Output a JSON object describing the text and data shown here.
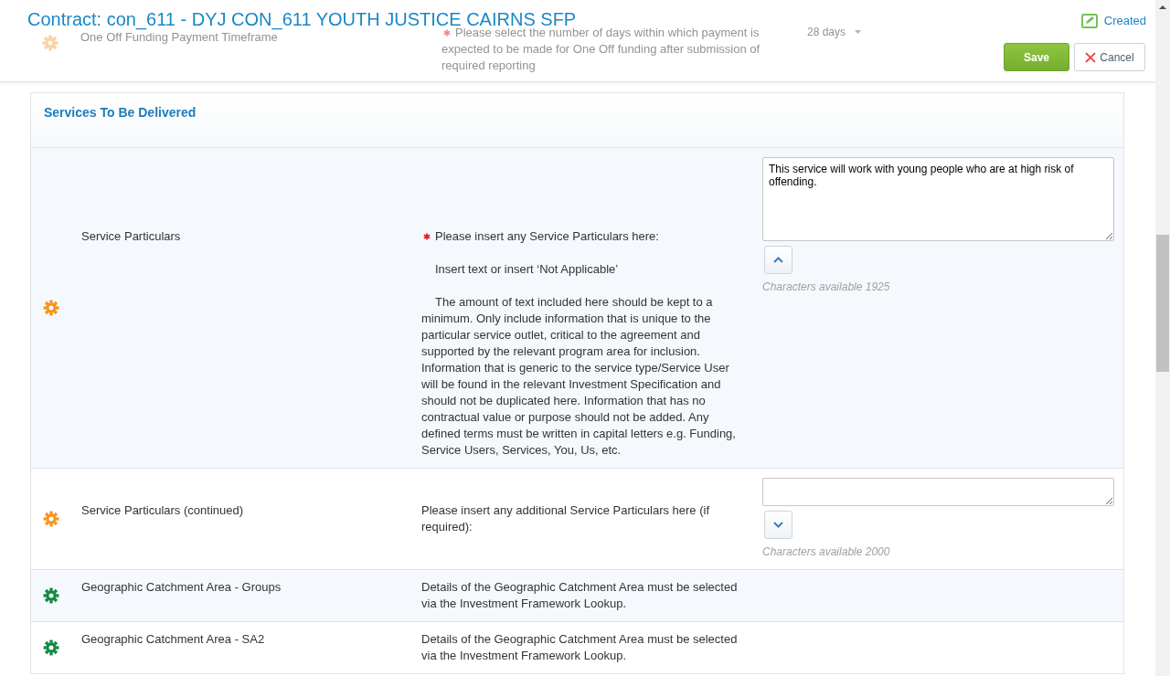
{
  "header": {
    "title": "Contract: con_611 - DYJ CON_611 YOUTH JUSTICE CAIRNS SFP",
    "status": "Created",
    "buttons": [
      {
        "kind": "save",
        "label": "Save"
      },
      {
        "kind": "cancel",
        "label": "Cancel"
      }
    ]
  },
  "previous_row": {
    "label": "One Off Funding Payment Timeframe",
    "required": true,
    "description": "Please select the number of days within which payment is expected to be made for One Off funding after submission of required reporting",
    "dropdown": {
      "value": "28 days"
    }
  },
  "section": {
    "title": "Services To Be Delivered",
    "rows": [
      {
        "kind": "entry",
        "label": "Service Particulars",
        "color": "#f7941d",
        "required": true,
        "description": [
          "Please insert any Service Particulars here:",
          "Insert text or insert ‘Not Applicable’",
          "The amount of text included here should be kept to a minimum. Only include information that is unique to the particular service outlet, critical to the agreement and supported by the relevant program area for inclusion. Information that is generic to the service type/Service User will be found in the relevant Investment Specification and should not be duplicated here. Information that has no contractual value or purpose should not be added. Any defined terms must be written in capital letters e.g. Funding, Service Users, Services, You, Us, etc."
        ],
        "value": "This service will work with young people who are at high risk of offending.",
        "expanded": true,
        "characters": "Characters available 1925"
      },
      {
        "kind": "entry",
        "label": "Service Particulars (continued)",
        "color": "#f7941d",
        "required": false,
        "description": [
          "Please insert any additional Service Particulars here (if required):"
        ],
        "expanded": false,
        "characters": "Characters available 2000"
      },
      {
        "kind": "info",
        "label": "Geographic Catchment Area - Groups",
        "color": "#128a43",
        "required": false,
        "description": [
          "Details of the Geographic Catchment Area must be selected via the Investment Framework Lookup."
        ]
      },
      {
        "kind": "info",
        "label": "Geographic Catchment Area - SA2",
        "color": "#128a43",
        "required": false,
        "description": [
          "Details of the Geographic Catchment Area must be selected via the Investment Framework Lookup."
        ]
      }
    ]
  }
}
